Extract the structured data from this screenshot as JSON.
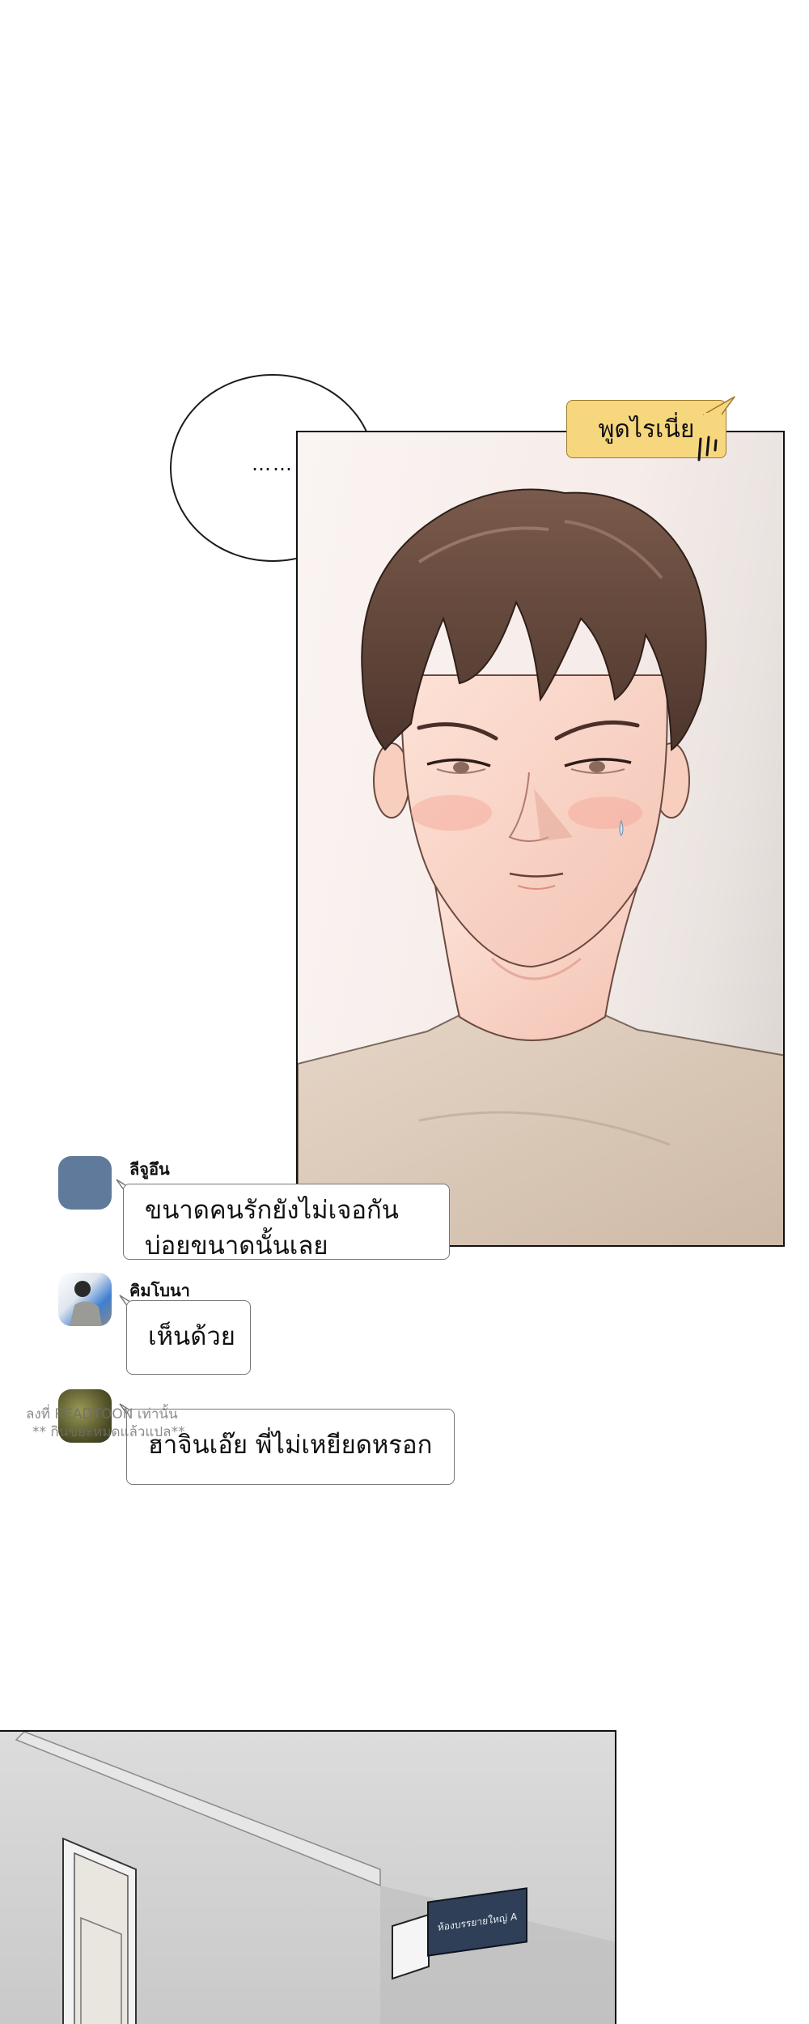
{
  "top_bubble": {
    "text": "……"
  },
  "yellow_tag": {
    "text": "พูดไรเนี่ย"
  },
  "comments": [
    {
      "name": "ลีจูอึน",
      "lines": [
        "ขนาดคนรักยังไม่เจอกัน",
        "บ่อยขนาดนั้นเลย"
      ],
      "avatar_color": "#5f7a9b"
    },
    {
      "name": "คิมโบนา",
      "lines": [
        "เห็นด้วย"
      ],
      "avatar_color": "#3f7fd0"
    },
    {
      "name": "",
      "lines": [
        "ฮาจินเอ๊ย พี่ไม่เหยียดหรอก"
      ],
      "avatar_color": "#6d6f3b"
    }
  ],
  "watermark": {
    "line1": "ลงที่ READTOON เท่านั้น",
    "line2": "** กินขยะหมดแล้วแปล**"
  },
  "room_sign": {
    "text": "ห้องบรรยายใหญ่ A"
  },
  "colors": {
    "tag_yellow": "#f7d77e",
    "sign_navy": "#2f3f57"
  }
}
